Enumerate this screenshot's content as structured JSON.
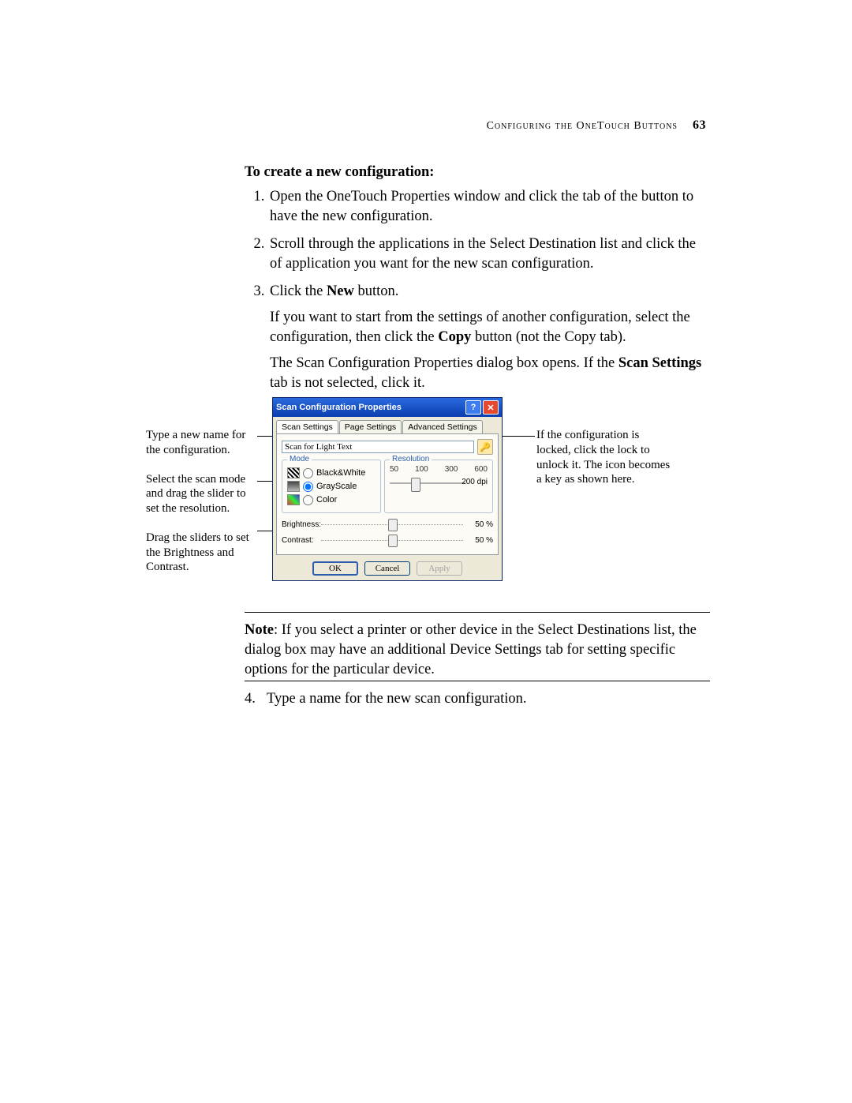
{
  "header": {
    "section": "Configuring the OneTouch Buttons",
    "page": "63"
  },
  "body": {
    "heading": "To create a new configuration:",
    "steps": {
      "s1": "Open the OneTouch Properties window and click the tab of the button to have the new configuration.",
      "s2": "Scroll through the applications in the Select Destination list and click the of application you want for the new scan configuration.",
      "s3a": "Click the ",
      "s3b_bold": "New",
      "s3c": " button.",
      "s3p2a": "If you want to start from the settings of another configuration, select the configuration, then click the ",
      "s3p2b_bold": "Copy",
      "s3p2c": " button (not the Copy tab).",
      "s3p3a": "The Scan Configuration Properties dialog box opens. If the ",
      "s3p3b_bold": "Scan Settings",
      "s3p3c": " tab is not selected, click it.",
      "s4": "Type a name for the new scan configuration."
    }
  },
  "callouts": {
    "c1": "Type a new name for the configuration.",
    "c2": "Select the scan mode and drag the slider to set the resolution.",
    "c3": "Drag the sliders to set the Brightness and Contrast.",
    "right": "If the configuration is locked, click the lock to unlock it. The icon becomes a key as shown here."
  },
  "dialog": {
    "title": "Scan Configuration Properties",
    "tabs": {
      "t1": "Scan Settings",
      "t2": "Page Settings",
      "t3": "Advanced Settings"
    },
    "name_value": "Scan for Light Text",
    "mode": {
      "legend": "Mode",
      "bw": "Black&White",
      "gs": "GrayScale",
      "color": "Color"
    },
    "resolution": {
      "legend": "Resolution",
      "t50": "50",
      "t100": "100",
      "t300": "300",
      "t600": "600",
      "value": "200 dpi"
    },
    "brightness_label": "Brightness:",
    "contrast_label": "Contrast:",
    "brightness_val": "50 %",
    "contrast_val": "50 %",
    "buttons": {
      "ok": "OK",
      "cancel": "Cancel",
      "apply": "Apply"
    }
  },
  "note": {
    "prefix_bold": "Note",
    "text": ":  If you select a printer or other device in the Select Destinations list, the dialog box may have an additional Device Settings tab for setting specific options for the particular device."
  }
}
